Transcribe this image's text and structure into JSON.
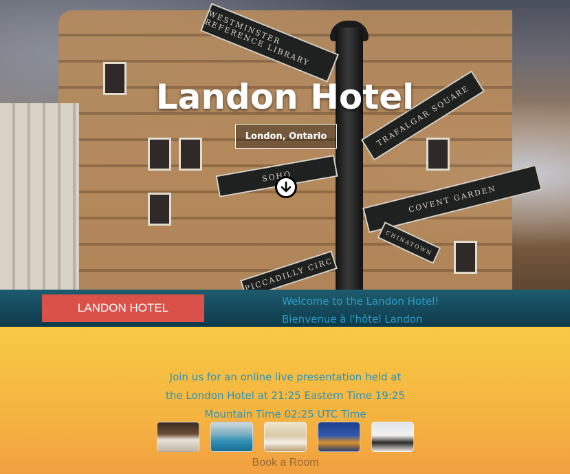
{
  "hero": {
    "title": "Landon Hotel",
    "subtitle": "London, Ontario",
    "scroll_icon": "arrow-down-circle-icon",
    "signs": [
      "WESTMINSTER REFERENCE LIBRARY",
      "TRAFALGAR SQUARE",
      "SOHO",
      "COVENT GARDEN",
      "PICCADILLY CIRC",
      "CHINATOWN"
    ]
  },
  "bar": {
    "logo_label": "LANDON HOTEL",
    "welcome_en": "Welcome to the Landon Hotel!",
    "welcome_fr": "Bienvenue à l'hôtel Landon"
  },
  "main": {
    "intro_line1": "Join us for an online live presentation held at",
    "intro_line2": "the London Hotel at 21:25 Eastern Time 19:25",
    "intro_line3": "Mountain Time 02:25 UTC Time",
    "book_label": "Book a Room"
  },
  "colors": {
    "logo_bg": "#d95148",
    "bar_bg": "#0d3a4b",
    "accent_text": "#2e93b8",
    "main_bg": "#f5b441"
  }
}
